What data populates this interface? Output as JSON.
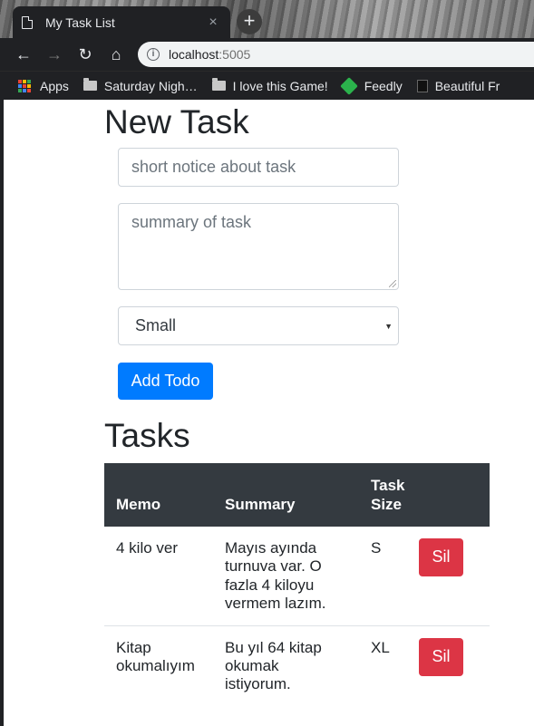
{
  "browser": {
    "tab_title": "My Task List",
    "tab_close": "×",
    "new_tab": "+",
    "url_host": "localhost",
    "url_port": ":5005",
    "nav": {
      "back": "←",
      "forward": "→",
      "reload": "↻",
      "home": "⌂"
    },
    "bookmarks": [
      "Apps",
      "Saturday Nigh…",
      "I love this Game!",
      "Feedly",
      "Beautiful Fr"
    ]
  },
  "form": {
    "heading": "New Task",
    "memo_placeholder": "short notice about task",
    "summary_placeholder": "summary of task",
    "size_selected": "Small",
    "submit_label": "Add Todo"
  },
  "tasks": {
    "heading": "Tasks",
    "columns": [
      "Memo",
      "Summary",
      "Task Size",
      ""
    ],
    "rows": [
      {
        "memo": "4 kilo ver",
        "summary": "Mayıs ayında turnuva var. O fazla 4 kiloyu vermem lazım.",
        "size": "S",
        "delete_label": "Sil"
      },
      {
        "memo": "Kitap okumalıyım",
        "summary": "Bu yıl 64 kitap okumak istiyorum.",
        "size": "XL",
        "delete_label": "Sil"
      }
    ]
  },
  "colors": {
    "primary": "#007bff",
    "danger": "#dc3545",
    "table_header": "#343a40"
  }
}
